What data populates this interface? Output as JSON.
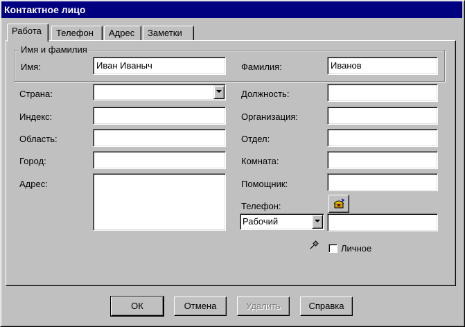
{
  "window": {
    "title": "Контактное лицо"
  },
  "tabs": [
    {
      "label": "Работа",
      "active": true
    },
    {
      "label": "Телефон",
      "active": false
    },
    {
      "label": "Адрес",
      "active": false
    },
    {
      "label": "Заметки",
      "active": false
    }
  ],
  "name_group": {
    "title": "Имя и фамилия",
    "first_name_label": "Имя:",
    "first_name_value": "Иван Иваныч",
    "last_name_label": "Фамилия:",
    "last_name_value": "Иванов"
  },
  "left_fields": {
    "country_label": "Страна:",
    "country_value": "",
    "index_label": "Индекс:",
    "index_value": "",
    "region_label": "Область:",
    "region_value": "",
    "city_label": "Город:",
    "city_value": "",
    "address_label": "Адрес:",
    "address_value": ""
  },
  "right_fields": {
    "position_label": "Должность:",
    "position_value": "",
    "organization_label": "Организация:",
    "organization_value": "",
    "department_label": "Отдел:",
    "department_value": "",
    "room_label": "Комната:",
    "room_value": "",
    "assistant_label": "Помощник:",
    "assistant_value": "",
    "phone_label": "Телефон:",
    "phone_type_value": "Рабочий",
    "phone_number_value": "",
    "private_label": "Личное",
    "private_checked": false
  },
  "buttons": {
    "ok": "ОК",
    "cancel": "Отмена",
    "delete": "Удалить",
    "help": "Справка"
  },
  "icons": {
    "phone_dial": "phone-dial-icon",
    "pin": "pin-icon"
  }
}
